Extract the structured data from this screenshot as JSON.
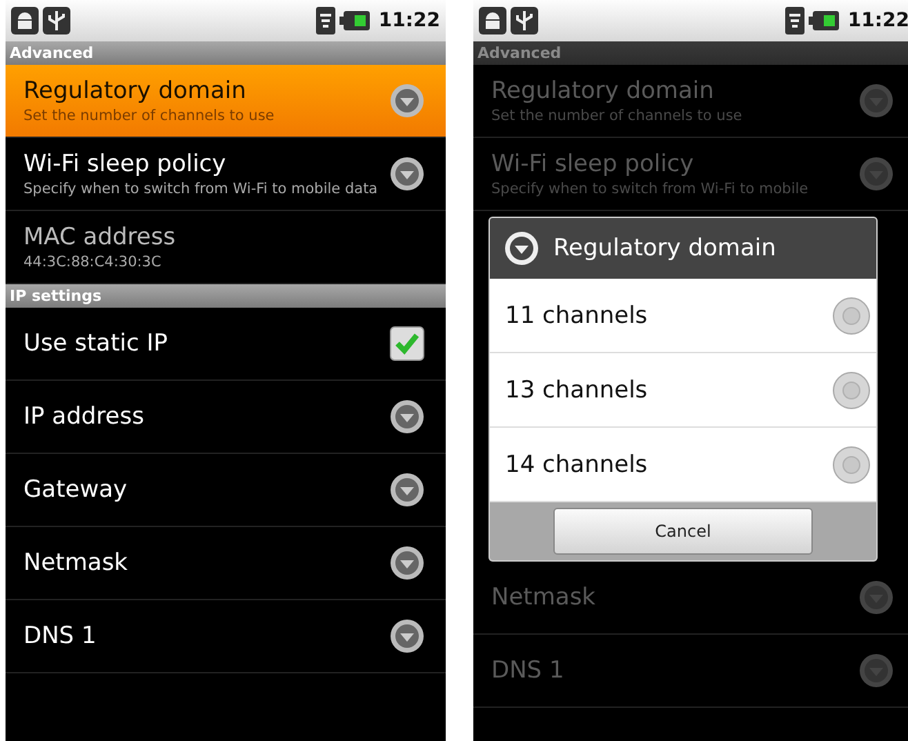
{
  "screens": [
    {
      "status_bar": {
        "time": "11:22"
      },
      "dimmed": false,
      "sections": [
        {
          "title": "Advanced",
          "items": [
            {
              "kind": "list",
              "title": "Regulatory domain",
              "subtitle": "Set the number of channels to use",
              "selected": true
            },
            {
              "kind": "list",
              "title": "Wi-Fi sleep policy",
              "subtitle": "Specify when to switch from Wi-Fi to mobile data",
              "selected": false
            },
            {
              "kind": "info",
              "title": "MAC address",
              "subtitle": "44:3C:88:C4:30:3C",
              "selected": false
            }
          ]
        },
        {
          "title": "IP settings",
          "items": [
            {
              "kind": "checkbox",
              "title": "Use static IP",
              "checked": true,
              "selected": false
            },
            {
              "kind": "list",
              "title": "IP address",
              "selected": false
            },
            {
              "kind": "list",
              "title": "Gateway",
              "selected": false
            },
            {
              "kind": "list",
              "title": "Netmask",
              "selected": false
            },
            {
              "kind": "list",
              "title": "DNS 1",
              "selected": false
            }
          ]
        }
      ]
    },
    {
      "status_bar": {
        "time": "11:22"
      },
      "dimmed": true,
      "sections": [
        {
          "title": "Advanced",
          "items": [
            {
              "kind": "list",
              "title": "Regulatory domain",
              "subtitle": "Set the number of channels to use",
              "selected": false
            },
            {
              "kind": "list",
              "title": "Wi-Fi sleep policy",
              "subtitle": "Specify when to switch from Wi-Fi to mobile",
              "selected": false
            }
          ]
        }
      ],
      "dialog": {
        "title": "Regulatory domain",
        "options": [
          {
            "label": "11 channels",
            "selected": false
          },
          {
            "label": "13 channels",
            "selected": false
          },
          {
            "label": "14 channels",
            "selected": false
          }
        ],
        "button": "Cancel"
      },
      "after_dialog": [
        {
          "kind": "list",
          "title": "Netmask",
          "selected": false
        },
        {
          "kind": "list",
          "title": "DNS 1",
          "selected": false
        }
      ]
    }
  ]
}
